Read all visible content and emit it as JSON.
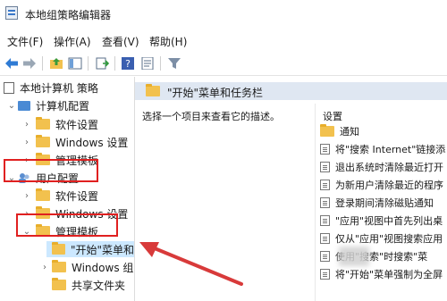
{
  "window": {
    "title": "本地组策略编辑器"
  },
  "menu": [
    {
      "label": "文件(F)"
    },
    {
      "label": "操作(A)"
    },
    {
      "label": "查看(V)"
    },
    {
      "label": "帮助(H)"
    }
  ],
  "toolbar": {
    "icons": [
      "back-arrow-icon",
      "forward-arrow-icon",
      "folder-up-icon",
      "show-hide-tree-icon",
      "export-list-icon",
      "help-icon",
      "properties-icon",
      "filter-icon"
    ]
  },
  "tree": {
    "root": "本地计算机 策略",
    "computer_config": "计算机配置",
    "cc_software": "软件设置",
    "cc_windows": "Windows 设置",
    "cc_admin": "管理模板",
    "user_config": "用户配置",
    "uc_software": "软件设置",
    "uc_windows": "Windows 设置",
    "uc_admin": "管理模板",
    "start_menu": "\"开始\"菜单和",
    "windows_comp": "Windows 组",
    "shared_folders": "共享文件夹"
  },
  "content": {
    "header": "\"开始\"菜单和任务栏",
    "description_prompt": "选择一个项目来查看它的描述。",
    "settings_col": "设置",
    "items": [
      "通知",
      "将\"搜索 Internet\"链接添",
      "退出系统时清除最近打开",
      "为新用户清除最近的程序",
      "登录期间清除磁贴通知",
      "\"应用\"视图中首先列出桌",
      "仅从\"应用\"视图搜索应用",
      "使用\"搜索\"时搜索\"菜",
      "将\"开始\"菜单强制为全屏"
    ]
  },
  "colors": {
    "highlight": "#e02020",
    "folder": "#f2c14e",
    "header_band": "#dfe7f2"
  }
}
